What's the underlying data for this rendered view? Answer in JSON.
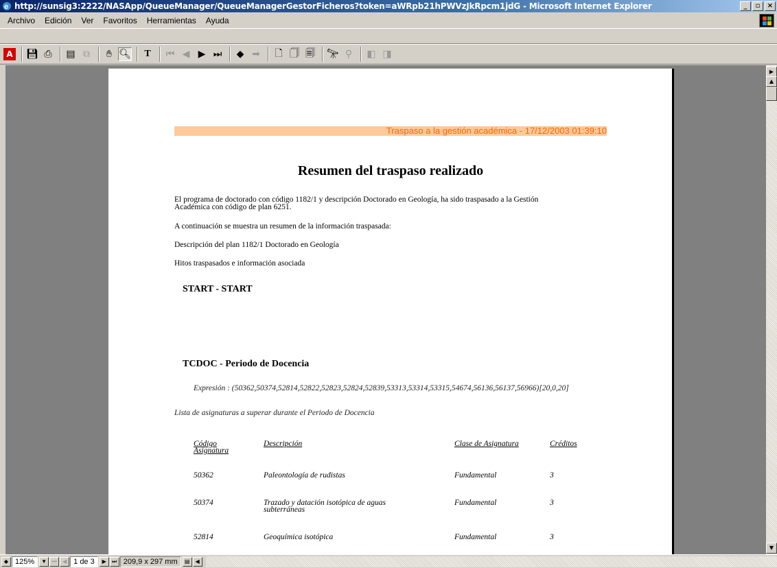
{
  "window": {
    "title": "http://sunsig3:2222/NASApp/QueueManager/QueueManagerGestorFicheros?token=aWRpb21hPWVzJkRpcm1jdG - Microsoft Internet Explorer"
  },
  "menu": {
    "items": [
      "Archivo",
      "Edición",
      "Ver",
      "Favoritos",
      "Herramientas",
      "Ayuda"
    ]
  },
  "document": {
    "header": "Traspaso a la gestión académica - 17/12/2003 01:39:10",
    "title": "Resumen del traspaso realizado",
    "intro_line1": "El programa de doctorado con código 1182/1 y descripción Doctorado en Geología, ha sido traspasado a la Gestión",
    "intro_line2": "Académica con código de plan 6251.",
    "summary_intro": "A continuación se muestra un resumen de la información traspasada:",
    "plan_description": "Descripción del plan 1182/1 Doctorado en Geología",
    "hitos_label": "Hitos traspasados e información asociada",
    "section1_heading": "START - START",
    "section2_heading": "TCDOC - Periodo de Docencia",
    "expression": "Expresión : (50362,50374,52814,52822,52823,52824,52839,53313,53314,53315,54674,56136,56137,56966)[20,0,20]",
    "subjects_intro": "Lista de asignaturas a superar durante el Periodo de Docencia",
    "table": {
      "headers": {
        "code_line1": "Código",
        "code_line2": "Asignatura",
        "description": "Descripción",
        "class": "Clase de Asignatura",
        "credits": "Créditos"
      },
      "rows": [
        {
          "code": "50362",
          "desc1": "Paleontología de rudistas",
          "desc2": "",
          "class": "Fundamental",
          "credits": "3"
        },
        {
          "code": "50374",
          "desc1": "Trazado y datación isotópica de aguas",
          "desc2": "subterráneas",
          "class": "Fundamental",
          "credits": "3"
        },
        {
          "code": "52814",
          "desc1": "Geoquímica isotópica",
          "desc2": "",
          "class": "Fundamental",
          "credits": "3"
        }
      ]
    }
  },
  "statusbar": {
    "zoom": "125%",
    "page_indicator": "1 de 3",
    "page_size": "209,9 x 297 mm"
  }
}
